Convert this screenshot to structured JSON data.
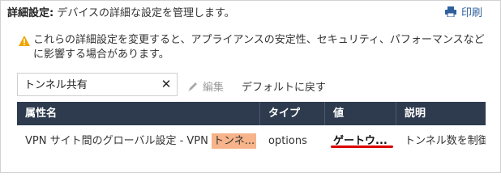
{
  "header": {
    "title_bold": "詳細設定:",
    "title_rest": " デバイスの詳細な設定を管理します。",
    "print_label": "印刷"
  },
  "warning": {
    "text": "これらの詳細設定を変更すると、アプライアンスの安定性、セキュリティ、パフォーマンスなどに影響する場合があります。"
  },
  "toolbar": {
    "search_value": "トンネル共有",
    "clear_label": "✕",
    "edit_label": "編集",
    "reset_label": "デフォルトに戻す"
  },
  "table": {
    "columns": [
      "属性名",
      "タイプ",
      "値",
      "説明"
    ],
    "rows": [
      {
        "name_prefix": "VPN サイト間のグローバル設定 - VPN ",
        "name_highlight": "トンネ...",
        "type": "options",
        "value": "ゲートウ...",
        "description": "トンネル数を制御"
      }
    ]
  },
  "colors": {
    "header_bg": "#2e3b4e",
    "highlight": "#f7b38a",
    "link": "#2f5f9e",
    "warning": "#f0a500",
    "mark": "#d90000"
  }
}
